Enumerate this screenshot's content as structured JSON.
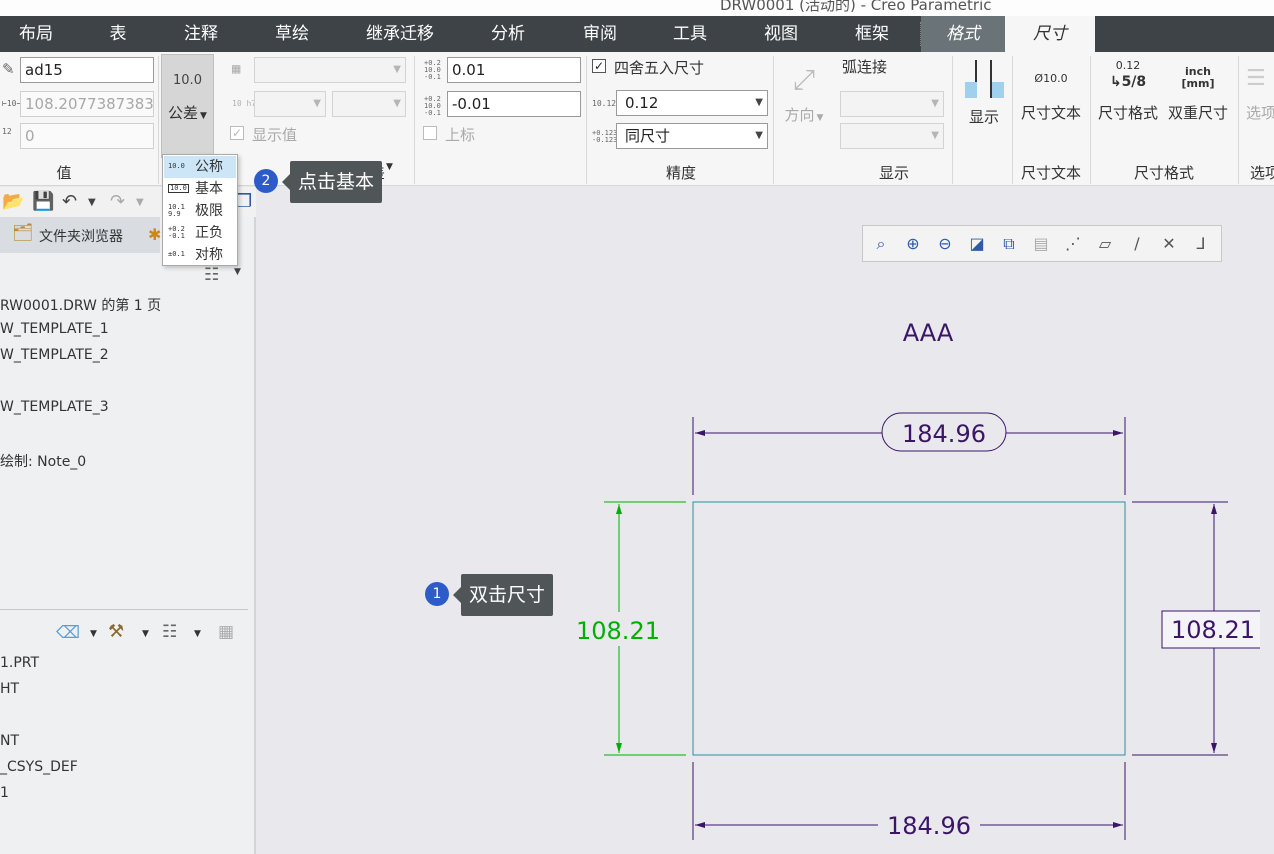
{
  "window": {
    "title": "DRW0001 (活动的) - Creo Parametric"
  },
  "menu_tabs": [
    "布局",
    "表",
    "注释",
    "草绘",
    "继承迁移",
    "分析",
    "审阅",
    "工具",
    "视图",
    "框架",
    "格式",
    "尺寸"
  ],
  "ribbon": {
    "value_group": {
      "name_value": "ad15",
      "value_field": "108.2077387383",
      "decimal_field": "0",
      "label": "值"
    },
    "tolerance_group": {
      "button_icon_text": "10.0",
      "button_label": "公差",
      "show_value_label": "显示值",
      "label": "公差"
    },
    "upper_tol": "0.01",
    "lower_tol": "-0.01",
    "superscript_label": "上标",
    "precision_group": {
      "round_label": "四舍五入尺寸",
      "decimals": "0.12",
      "tol_decimals": "同尺寸",
      "label": "精度"
    },
    "display_group": {
      "direction_label": "方向",
      "arc_label": "弧连接",
      "display_label": "显示",
      "label": "显示"
    },
    "dim_text_group": {
      "icon_text": "Ø10.0",
      "button_label": "尺寸文本",
      "label": "尺寸文本"
    },
    "dim_format_group": {
      "format_icon_top": "0.12",
      "format_icon_bottom": "5/8",
      "format_label": "尺寸格式",
      "dual_icon_top": "inch",
      "dual_icon_bottom": "[mm]",
      "dual_label": "双重尺寸",
      "label": "尺寸格式"
    },
    "options_group": {
      "button_label": "选项",
      "label": "选项"
    }
  },
  "tolerance_menu": [
    {
      "icon": "10.0",
      "label": "公称"
    },
    {
      "icon": "10.0",
      "label": "基本"
    },
    {
      "icon": "10.1 9.9",
      "label": "极限"
    },
    {
      "icon": "+0.2 -0.1",
      "label": "正负"
    },
    {
      "icon": "±0.1",
      "label": "对称"
    }
  ],
  "left_panel": {
    "tab_label": "文件夹浏览器",
    "tree_top": [
      "RW0001.DRW 的第 1 页",
      "W_TEMPLATE_1",
      "W_TEMPLATE_2",
      "",
      "W_TEMPLATE_3",
      "绘制: Note_0"
    ],
    "tree_bottom": [
      "1.PRT",
      "HT",
      "",
      "NT",
      "_CSYS_DEF",
      "1"
    ]
  },
  "callouts": [
    {
      "number": "1",
      "text": "双击尺寸"
    },
    {
      "number": "2",
      "text": "点击基本"
    }
  ],
  "drawing": {
    "note": "AAA",
    "top_dim": "184.96",
    "bottom_dim": "184.96",
    "left_dim": "108.21",
    "right_dim": "108.21"
  },
  "colors": {
    "menu_bg": "#3e4347",
    "selected_dim": "#00b000",
    "dimension": "#3b1566",
    "geometry": "#2a8fa0",
    "callout_badge": "#2d5bc8"
  }
}
